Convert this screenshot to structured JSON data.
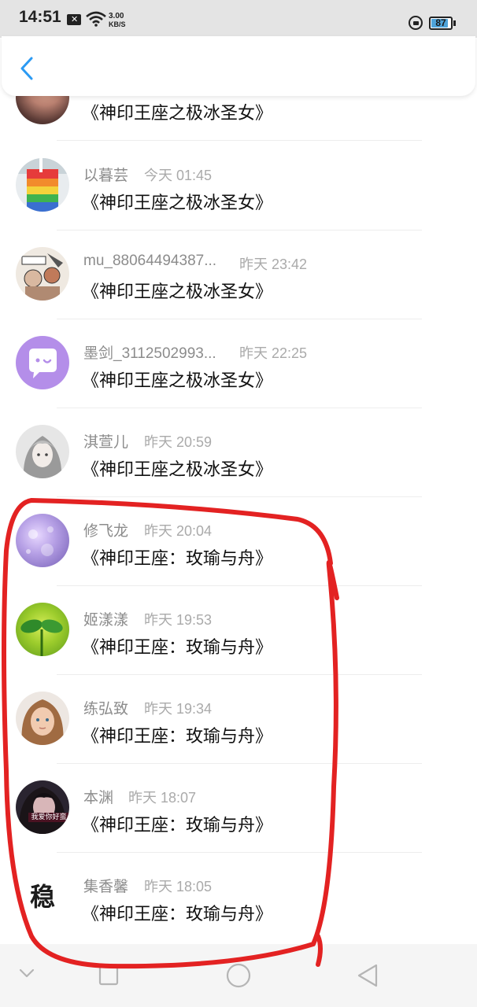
{
  "status_bar": {
    "time": "14:51",
    "net_speed_value": "3.00",
    "net_speed_unit": "KB/S",
    "battery": "87"
  },
  "colors": {
    "accent": "#2b9af3",
    "annotation": "#e32222"
  },
  "items": [
    {
      "name": "",
      "time": "",
      "title": "《神印王座之极冰圣女》",
      "avatar": "avatar-photo-icon"
    },
    {
      "name": "以暮芸",
      "time": "今天 01:45",
      "title": "《神印王座之极冰圣女》",
      "avatar": "rainbow-drink-icon"
    },
    {
      "name": "mu_88064494387...",
      "time": "昨天 23:42",
      "title": "《神印王座之极冰圣女》",
      "avatar": "sketch-avatar-icon"
    },
    {
      "name": "墨剑_3112502993...",
      "time": "昨天 22:25",
      "title": "《神印王座之极冰圣女》",
      "avatar": "chat-bubble-icon"
    },
    {
      "name": "淇萱儿",
      "time": "昨天 20:59",
      "title": "《神印王座之极冰圣女》",
      "avatar": "anime-girl-icon"
    },
    {
      "name": "修飞龙",
      "time": "昨天 20:04",
      "title": "《神印王座：玫瑜与舟》",
      "avatar": "purple-bokeh-icon"
    },
    {
      "name": "姬漾漾",
      "time": "昨天 19:53",
      "title": "《神印王座：玫瑜与舟》",
      "avatar": "sprout-icon"
    },
    {
      "name": "练弘致",
      "time": "昨天 19:34",
      "title": "《神印王座：玫瑜与舟》",
      "avatar": "girl-portrait-icon"
    },
    {
      "name": "本渊",
      "time": "昨天 18:07",
      "title": "《神印王座：玫瑜与舟》",
      "avatar": "dark-portrait-icon",
      "avatar_caption": "我爱你好蛮"
    },
    {
      "name": "集香馨",
      "time": "昨天 18:05",
      "title": "《神印王座：玫瑜与舟》",
      "avatar": "text-avatar-icon",
      "avatar_text": "稳"
    }
  ]
}
